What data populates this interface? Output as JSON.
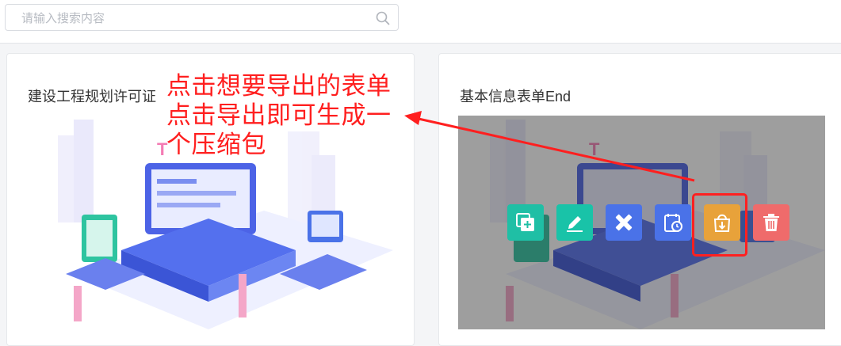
{
  "search": {
    "placeholder": "请输入搜索内容",
    "value": ""
  },
  "cards": [
    {
      "title": "建设工程规划许可证"
    },
    {
      "title": "基本信息表单End"
    }
  ],
  "actions": [
    {
      "icon": "copy-add-icon",
      "color": "#1fbfa5"
    },
    {
      "icon": "edit-pencil-icon",
      "color": "#19c3a8"
    },
    {
      "icon": "design-ruler-icon",
      "color": "#4a72e8"
    },
    {
      "icon": "schedule-icon",
      "color": "#4a72e8"
    },
    {
      "icon": "export-bag-icon",
      "color": "#e8a23a"
    },
    {
      "icon": "trash-icon",
      "color": "#ef6b6b"
    }
  ],
  "annotation": {
    "lines": [
      "点击想要导出的表单",
      "点击导出即可生成一",
      "个压缩包"
    ],
    "color": "#ff1f1f"
  }
}
